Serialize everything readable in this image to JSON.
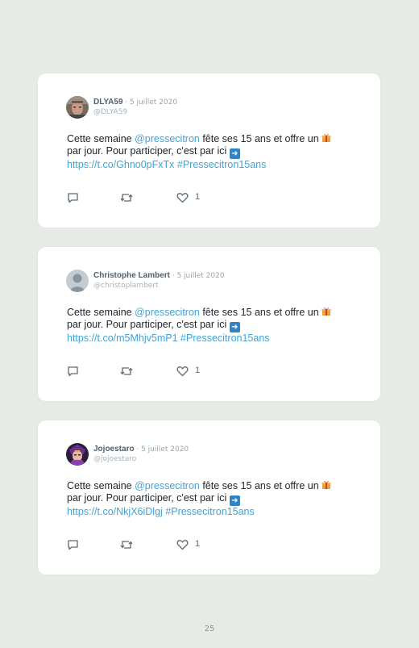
{
  "tweets": [
    {
      "name": "DLYA59",
      "date": "5 juillet 2020",
      "handle": "@DLYA59",
      "text_pre": "Cette semaine ",
      "mention": "@pressecitron",
      "text_mid": " fête ses 15 ans et offre un ",
      "text_line2": "par jour. Pour participer, c'est par ici ",
      "link": "https://t.co/Ghno0pFxTx",
      "hashtag": "#Pressecitron15ans",
      "likes": "1",
      "avatar": "photo-portrait"
    },
    {
      "name": "Christophe Lambert",
      "date": "5 juillet 2020",
      "handle": "@christoplambert",
      "text_pre": "Cette semaine ",
      "mention": "@pressecitron",
      "text_mid": " fête ses 15 ans et offre un ",
      "text_line2": "par jour. Pour participer, c'est par ici ",
      "link": "https://t.co/m5Mhjv5mP1",
      "hashtag": "#Pressecitron15ans",
      "likes": "1",
      "avatar": "default-user"
    },
    {
      "name": "Jojoestaro",
      "date": "5 juillet 2020",
      "handle": "@jojoestaro",
      "text_pre": "Cette semaine ",
      "mention": "@pressecitron",
      "text_mid": " fête ses 15 ans et offre un ",
      "text_line2": "par jour. Pour participer, c'est par ici ",
      "link": "https://t.co/NkjX6iDlgj",
      "hashtag": "#Pressecitron15ans",
      "likes": "1",
      "avatar": "anime-character"
    }
  ],
  "separator": "·",
  "page_number": "25",
  "colors": {
    "background": "#e6ebe5",
    "link": "#3fa3d8",
    "name": "#505f6d"
  }
}
